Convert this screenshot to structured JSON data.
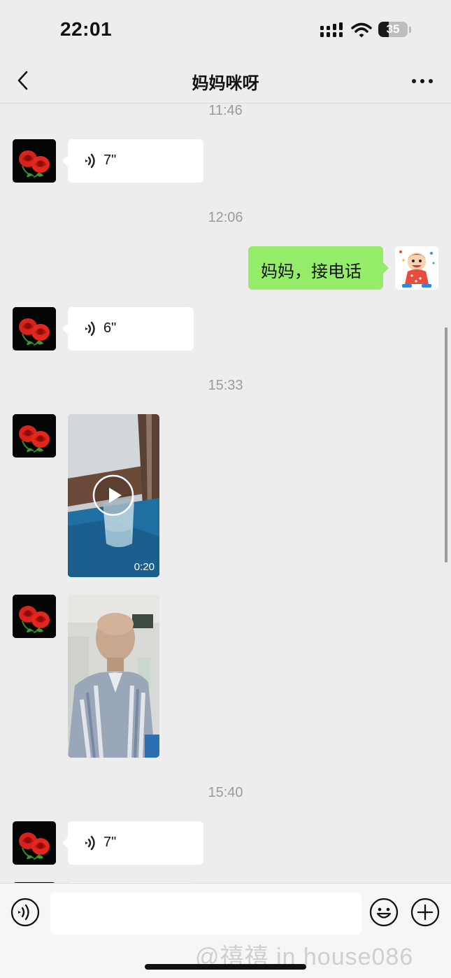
{
  "status_bar": {
    "time": "22:01",
    "battery_level": "35",
    "battery_fraction": 0.35
  },
  "nav": {
    "title": "妈妈咪呀",
    "back_icon": "chevron-left-icon",
    "more_icon": "more-dots-icon"
  },
  "chat": {
    "timestamps": [
      "11:46",
      "12:06",
      "15:33",
      "15:40"
    ],
    "messages": [
      {
        "sender": "mom",
        "type": "voice",
        "duration": "7\""
      },
      {
        "sender": "me",
        "type": "text",
        "text": "妈妈，接电话"
      },
      {
        "sender": "mom",
        "type": "voice",
        "duration": "6\""
      },
      {
        "sender": "mom",
        "type": "video",
        "duration": "0:20"
      },
      {
        "sender": "mom",
        "type": "image"
      },
      {
        "sender": "mom",
        "type": "voice",
        "duration": "7\""
      }
    ]
  },
  "input_bar": {
    "placeholder": "",
    "voice_icon": "voice-mode-icon",
    "emoji_icon": "emoji-icon",
    "plus_icon": "plus-icon"
  },
  "watermark": "@禧禧 in house086",
  "colors": {
    "background": "#ededed",
    "incoming_bubble": "#ffffff",
    "outgoing_bubble": "#95ec69",
    "timestamp": "#9b9b9b"
  }
}
